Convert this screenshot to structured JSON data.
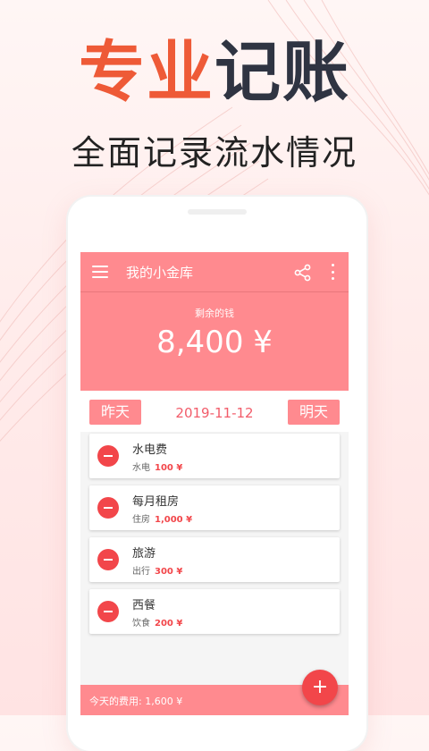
{
  "promo": {
    "headline_accent": "专业",
    "headline_rest": "记账",
    "subheadline": "全面记录流水情况"
  },
  "appbar": {
    "title": "我的小金库",
    "menu_icon": "menu-icon",
    "share_icon": "share-icon",
    "more_icon": "more-vert-icon"
  },
  "balance": {
    "label": "剩余的钱",
    "value": "8,400 ¥"
  },
  "datebar": {
    "prev_label": "昨天",
    "date": "2019-11-12",
    "next_label": "明天"
  },
  "expenses": [
    {
      "title": "水电费",
      "category": "水电",
      "amount": "100 ¥"
    },
    {
      "title": "每月租房",
      "category": "住房",
      "amount": "1,000 ¥"
    },
    {
      "title": "旅游",
      "category": "出行",
      "amount": "300 ¥"
    },
    {
      "title": "西餐",
      "category": "饮食",
      "amount": "200 ¥"
    }
  ],
  "footer": {
    "text": "今天的费用: 1,600 ¥"
  },
  "fab": {
    "label": "+"
  },
  "colors": {
    "primary": "#ff8a8f",
    "accent": "#f2464a",
    "headline_orange": "#ee5a37",
    "headline_dark": "#2f3442"
  }
}
